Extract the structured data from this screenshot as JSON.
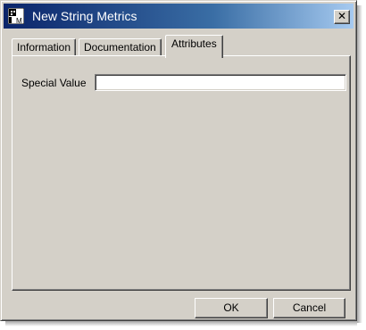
{
  "window": {
    "title": "New String Metrics",
    "icon": "class-metrics-icon",
    "close_label": "✕"
  },
  "tabs": [
    {
      "label": "Information",
      "active": false
    },
    {
      "label": "Documentation",
      "active": false
    },
    {
      "label": "Attributes",
      "active": true
    }
  ],
  "attributes": {
    "special_value_label": "Special Value",
    "special_value": ""
  },
  "buttons": {
    "ok": "OK",
    "cancel": "Cancel"
  },
  "colors": {
    "title_active_start": "#0a246a",
    "title_active_end": "#a6caf0",
    "face": "#d4d0c8"
  }
}
